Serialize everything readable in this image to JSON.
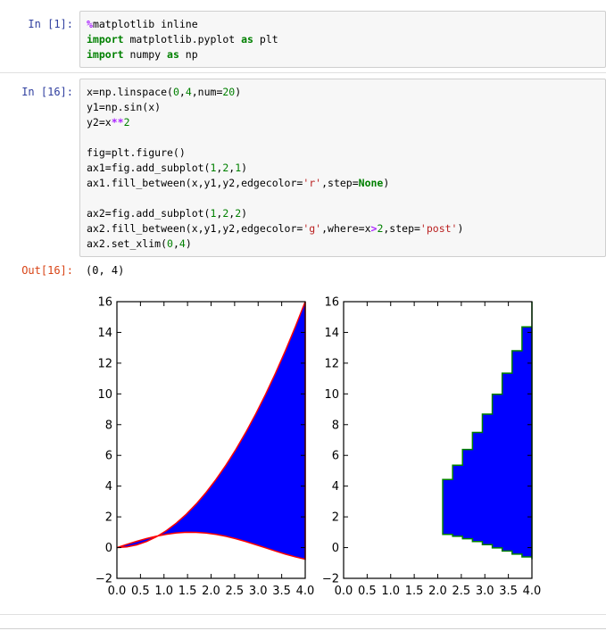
{
  "cells": [
    {
      "prompt": "In  [1]:",
      "lines": [
        [
          {
            "t": "%",
            "c": "mg"
          },
          {
            "t": "matplotlib inline",
            "c": ""
          }
        ],
        [
          {
            "t": "import",
            "c": "kw"
          },
          {
            "t": " matplotlib.pyplot ",
            "c": ""
          },
          {
            "t": "as",
            "c": "kw"
          },
          {
            "t": " plt",
            "c": ""
          }
        ],
        [
          {
            "t": "import",
            "c": "kw"
          },
          {
            "t": " numpy ",
            "c": ""
          },
          {
            "t": "as",
            "c": "kw"
          },
          {
            "t": " np",
            "c": ""
          }
        ]
      ]
    },
    {
      "prompt": "In  [16]:",
      "lines": [
        [
          {
            "t": "x=np.linspace(",
            "c": ""
          },
          {
            "t": "0",
            "c": "num"
          },
          {
            "t": ",",
            "c": ""
          },
          {
            "t": "4",
            "c": "num"
          },
          {
            "t": ",num=",
            "c": ""
          },
          {
            "t": "20",
            "c": "num"
          },
          {
            "t": ")",
            "c": ""
          }
        ],
        [
          {
            "t": "y1=np.sin(x)",
            "c": ""
          }
        ],
        [
          {
            "t": "y2=x",
            "c": ""
          },
          {
            "t": "**",
            "c": "op"
          },
          {
            "t": "2",
            "c": "num"
          }
        ],
        [
          {
            "t": "",
            "c": ""
          }
        ],
        [
          {
            "t": "fig=plt.figure()",
            "c": ""
          }
        ],
        [
          {
            "t": "ax1=fig.add_subplot(",
            "c": ""
          },
          {
            "t": "1",
            "c": "num"
          },
          {
            "t": ",",
            "c": ""
          },
          {
            "t": "2",
            "c": "num"
          },
          {
            "t": ",",
            "c": ""
          },
          {
            "t": "1",
            "c": "num"
          },
          {
            "t": ")",
            "c": ""
          }
        ],
        [
          {
            "t": "ax1.fill_between(x,y1,y2,edgecolor=",
            "c": ""
          },
          {
            "t": "'r'",
            "c": "str"
          },
          {
            "t": ",step=",
            "c": ""
          },
          {
            "t": "None",
            "c": "kw"
          },
          {
            "t": ")",
            "c": ""
          }
        ],
        [
          {
            "t": "",
            "c": ""
          }
        ],
        [
          {
            "t": "ax2=fig.add_subplot(",
            "c": ""
          },
          {
            "t": "1",
            "c": "num"
          },
          {
            "t": ",",
            "c": ""
          },
          {
            "t": "2",
            "c": "num"
          },
          {
            "t": ",",
            "c": ""
          },
          {
            "t": "2",
            "c": "num"
          },
          {
            "t": ")",
            "c": ""
          }
        ],
        [
          {
            "t": "ax2.fill_between(x,y1,y2,edgecolor=",
            "c": ""
          },
          {
            "t": "'g'",
            "c": "str"
          },
          {
            "t": ",where=x",
            "c": ""
          },
          {
            "t": ">",
            "c": "op"
          },
          {
            "t": "2",
            "c": "num"
          },
          {
            "t": ",step=",
            "c": ""
          },
          {
            "t": "'post'",
            "c": "str"
          },
          {
            "t": ")",
            "c": ""
          }
        ],
        [
          {
            "t": "ax2.set_xlim(",
            "c": ""
          },
          {
            "t": "0",
            "c": "num"
          },
          {
            "t": ",",
            "c": ""
          },
          {
            "t": "4",
            "c": "num"
          },
          {
            "t": ")",
            "c": ""
          }
        ]
      ]
    }
  ],
  "output": {
    "prompt": "Out[16]:",
    "text": "(0,  4)"
  },
  "chart_data": [
    {
      "type": "area",
      "fill_color": "#0000ff",
      "edge_color": "#ff0000",
      "step": null,
      "x_function": "linspace(0,4,20)",
      "y_lower": "sin(x)",
      "y_upper": "x**2",
      "xlim": [
        0,
        4
      ],
      "ylim": [
        -2,
        16
      ],
      "xticks": [
        "0.0",
        "0.5",
        "1.0",
        "1.5",
        "2.0",
        "2.5",
        "3.0",
        "3.5",
        "4.0"
      ],
      "yticks": [
        "−2",
        "0",
        "2",
        "4",
        "6",
        "8",
        "10",
        "12",
        "14",
        "16"
      ]
    },
    {
      "type": "area",
      "fill_color": "#0000ff",
      "edge_color": "#008000",
      "step": "post",
      "where": "x>2",
      "x_function": "linspace(0,4,20)",
      "y_lower": "sin(x)",
      "y_upper": "x**2",
      "xlim": [
        0,
        4
      ],
      "ylim": [
        -2,
        16
      ],
      "xticks": [
        "0.0",
        "0.5",
        "1.0",
        "1.5",
        "2.0",
        "2.5",
        "3.0",
        "3.5",
        "4.0"
      ],
      "yticks": [
        "−2",
        "0",
        "2",
        "4",
        "6",
        "8",
        "10",
        "12",
        "14",
        "16"
      ]
    }
  ]
}
